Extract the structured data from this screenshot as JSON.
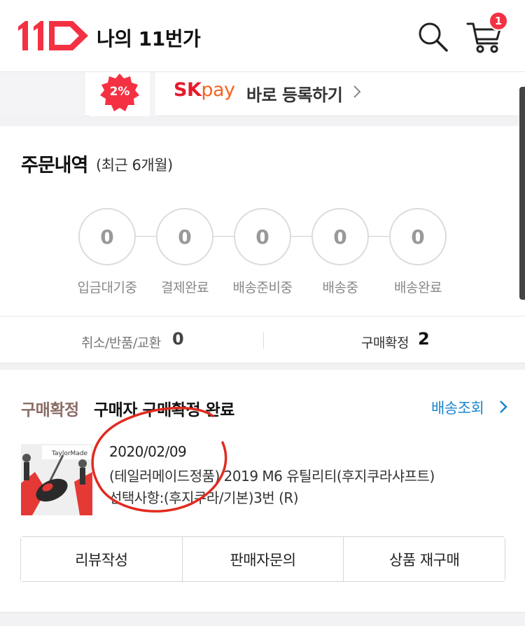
{
  "header": {
    "logo_text": "11",
    "title": "나의 11번가",
    "cart_count": "1",
    "colors": {
      "brand": "#f43142"
    },
    "icons": {
      "search": "search-icon",
      "cart": "cart-icon"
    }
  },
  "banner": {
    "discount": "2%",
    "brand_sk": "SK",
    "brand_pay": "pay",
    "text": "바로 등록하기"
  },
  "orders": {
    "title": "주문내역",
    "subtitle": "(최근 6개월)",
    "steps": [
      {
        "count": "0",
        "label": "입금대기중"
      },
      {
        "count": "0",
        "label": "결제완료"
      },
      {
        "count": "0",
        "label": "배송준비중"
      },
      {
        "count": "0",
        "label": "배송중"
      },
      {
        "count": "0",
        "label": "배송완료"
      }
    ],
    "summary": {
      "cancel_label": "취소/반품/교환",
      "cancel_count": "0",
      "confirm_label": "구매확정",
      "confirm_count": "2"
    }
  },
  "order_item": {
    "status_tag": "구매확정",
    "status_text": "구매자 구매확정 완료",
    "track_link": "배송조회",
    "date": "2020/02/09",
    "product_name": "(테일러메이드정품) 2019 M6 유틸리티(후지쿠라샤프트)",
    "option": "선택사항:(후지쿠라/기본)3번 (R)",
    "actions": [
      "리뷰작성",
      "판매자문의",
      "상품 재구매"
    ],
    "colors": {
      "status": "#8b6d64",
      "link": "#1a86d0",
      "annotation": "#e02b20"
    }
  }
}
